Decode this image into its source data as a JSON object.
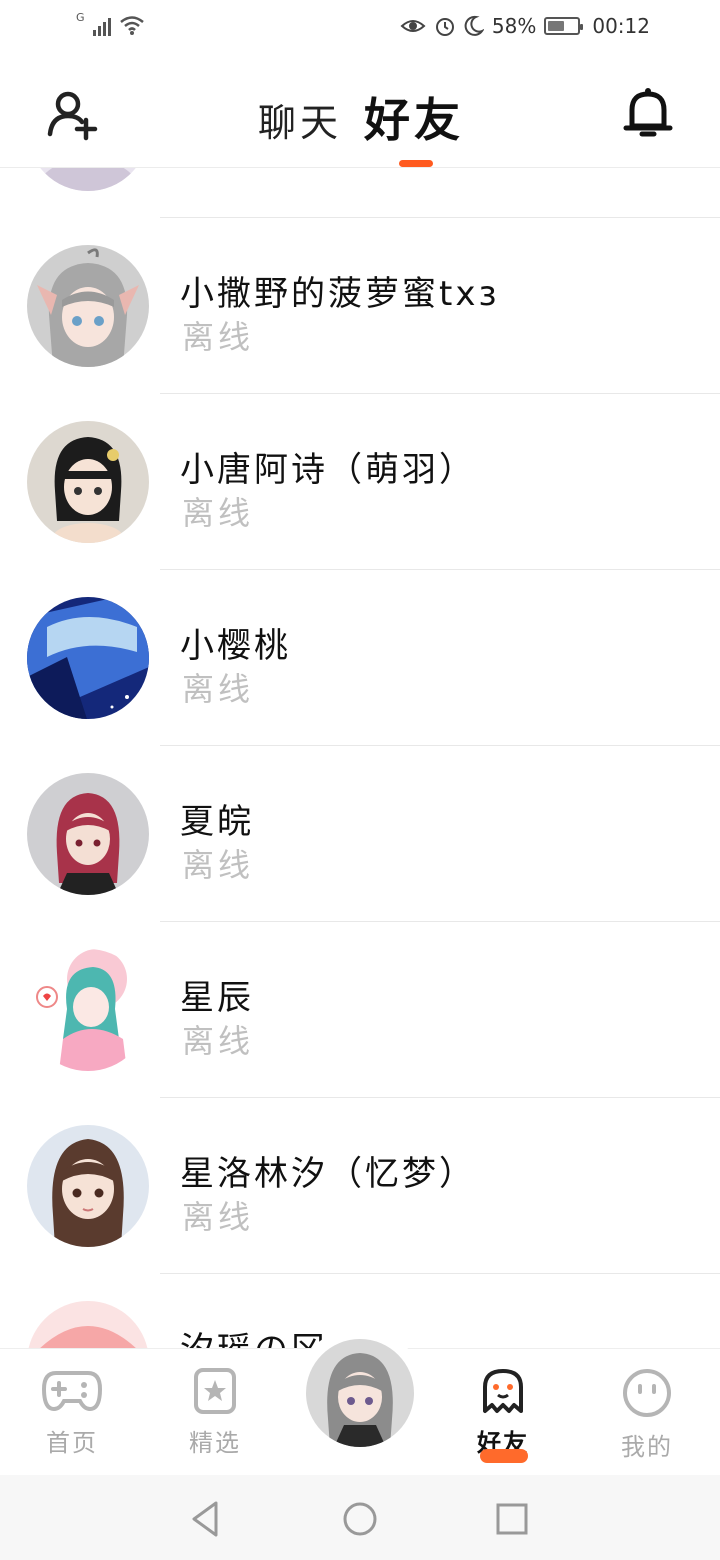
{
  "status_bar": {
    "network": "G",
    "battery_text": "58%",
    "battery_level": 0.58,
    "time": "00:12",
    "icons": [
      "signal-icon",
      "wifi-icon",
      "eye-comfort-icon",
      "alarm-icon",
      "moon-icon",
      "battery-icon"
    ]
  },
  "header": {
    "tabs": [
      {
        "label": "聊天",
        "active": false
      },
      {
        "label": "好友",
        "active": true
      }
    ],
    "left_icon": "add-friend-icon",
    "right_icon": "bell-icon",
    "accent_color": "#ff5a1f"
  },
  "friends": [
    {
      "name": "",
      "status": "离线",
      "avatar": "partial-avatar"
    },
    {
      "name": "小撒野的菠萝蜜txз",
      "status": "离线",
      "avatar": "silver-hair-catgirl-avatar"
    },
    {
      "name": "小唐阿诗（萌羽）",
      "status": "离线",
      "avatar": "black-hair-girl-avatar"
    },
    {
      "name": "小樱桃",
      "status": "离线",
      "avatar": "blue-sky-avatar"
    },
    {
      "name": "夏皖",
      "status": "离线",
      "avatar": "red-hair-girl-avatar"
    },
    {
      "name": "星辰",
      "status": "离线",
      "avatar": "pink-dress-girl-avatar"
    },
    {
      "name": "星洛林汐（忆梦）",
      "status": "离线",
      "avatar": "brown-hair-girl-avatar"
    },
    {
      "name": "汐瑶の冈",
      "status": "",
      "avatar": "pink-hat-girl-avatar"
    }
  ],
  "bottom_nav": {
    "items": [
      {
        "label": "首页",
        "icon": "gamepad-icon",
        "active": false
      },
      {
        "label": "精选",
        "icon": "star-icon",
        "active": false
      },
      {
        "label": "",
        "icon": "center-avatar-icon",
        "active": false
      },
      {
        "label": "好友",
        "icon": "ghost-icon",
        "active": true
      },
      {
        "label": "我的",
        "icon": "smiley-icon",
        "active": false
      }
    ],
    "active_color": "#ff6a2b"
  },
  "system_nav": {
    "icons": [
      "back-icon",
      "home-icon",
      "recents-icon"
    ]
  }
}
